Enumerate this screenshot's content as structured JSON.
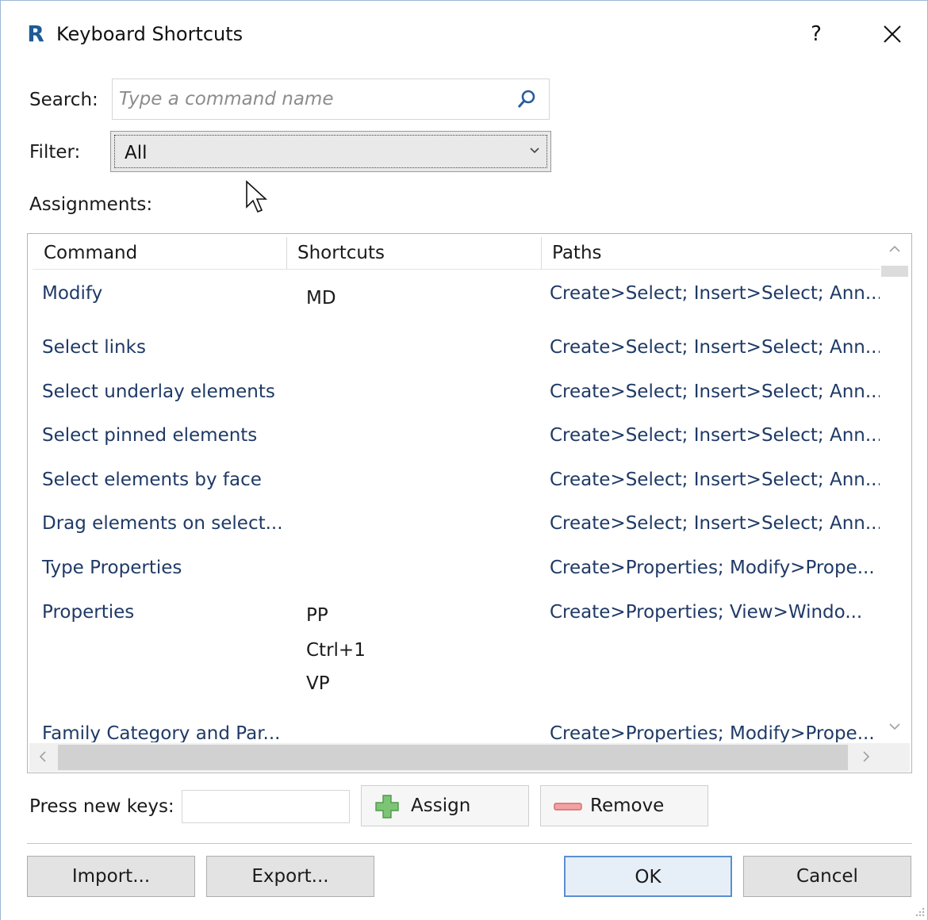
{
  "window": {
    "title": "Keyboard Shortcuts",
    "app_icon_letter": "R",
    "help_label": "?"
  },
  "search": {
    "label": "Search:",
    "placeholder": "Type a command name"
  },
  "filter": {
    "label": "Filter:",
    "selected": "All"
  },
  "assignments": {
    "label": "Assignments:",
    "columns": [
      "Command",
      "Shortcuts",
      "Paths"
    ],
    "rows": [
      {
        "command": "Modify",
        "shortcuts": [
          "MD"
        ],
        "path": "Create>Select; Insert>Select; Ann..."
      },
      {
        "command": "Select links",
        "shortcuts": [],
        "path": "Create>Select; Insert>Select; Ann..."
      },
      {
        "command": "Select underlay elements",
        "shortcuts": [],
        "path": "Create>Select; Insert>Select; Ann..."
      },
      {
        "command": "Select pinned elements",
        "shortcuts": [],
        "path": "Create>Select; Insert>Select; Ann..."
      },
      {
        "command": "Select elements by face",
        "shortcuts": [],
        "path": "Create>Select; Insert>Select; Ann..."
      },
      {
        "command": "Drag elements on select...",
        "shortcuts": [],
        "path": "Create>Select; Insert>Select; Ann..."
      },
      {
        "command": "Type Properties",
        "shortcuts": [],
        "path": "Create>Properties; Modify>Prope..."
      },
      {
        "command": "Properties",
        "shortcuts": [
          "PP",
          "Ctrl+1",
          "VP"
        ],
        "path": "Create>Properties; View>Windo..."
      },
      {
        "command": "Family Category and Par...",
        "shortcuts": [],
        "path": "Create>Properties; Modify>Prope..."
      }
    ]
  },
  "press_keys": {
    "label": "Press new keys:",
    "value": ""
  },
  "buttons": {
    "assign": "Assign",
    "remove": "Remove",
    "import": "Import...",
    "export": "Export...",
    "ok": "OK",
    "cancel": "Cancel"
  },
  "colors": {
    "accent": "#5a8fd0",
    "link_text": "#1f3a66",
    "app_icon": "#1e5a96",
    "assign_plus": "#5cb85c",
    "remove_minus": "#e06b6b"
  },
  "icons": [
    "app-icon",
    "help-icon",
    "close-icon",
    "search-icon",
    "chevron-down-icon",
    "plus-icon",
    "minus-icon",
    "mouse-cursor-icon"
  ]
}
